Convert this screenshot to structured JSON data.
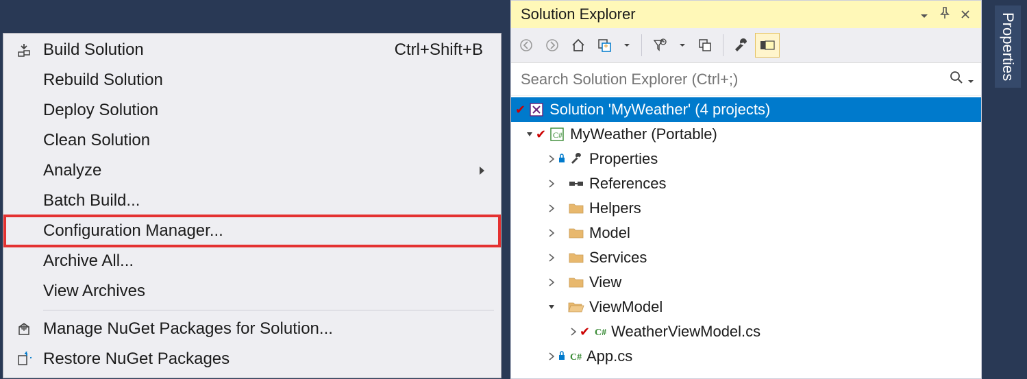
{
  "menu": {
    "items": [
      {
        "label": "Build Solution",
        "shortcut": "Ctrl+Shift+B",
        "icon": "build"
      },
      {
        "label": "Rebuild Solution"
      },
      {
        "label": "Deploy Solution"
      },
      {
        "label": "Clean Solution"
      },
      {
        "label": "Analyze",
        "submenu": true
      },
      {
        "label": "Batch Build..."
      },
      {
        "label": "Configuration Manager...",
        "highlighted": true
      },
      {
        "label": "Archive All..."
      },
      {
        "label": "View Archives"
      }
    ],
    "sep_after_index": 8,
    "items2": [
      {
        "label": "Manage NuGet Packages for Solution...",
        "icon": "package"
      },
      {
        "label": "Restore NuGet Packages",
        "icon": "restore"
      }
    ]
  },
  "panel": {
    "title": "Solution Explorer",
    "search_placeholder": "Search Solution Explorer (Ctrl+;)"
  },
  "tree": {
    "solution_label": "Solution 'MyWeather' (4 projects)",
    "project_label": "MyWeather (Portable)",
    "nodes": [
      {
        "label": "Properties",
        "icon": "wrench",
        "arrow": "right"
      },
      {
        "label": "References",
        "icon": "ref",
        "arrow": "right"
      },
      {
        "label": "Helpers",
        "icon": "folder",
        "arrow": "right"
      },
      {
        "label": "Model",
        "icon": "folder",
        "arrow": "right"
      },
      {
        "label": "Services",
        "icon": "folder",
        "arrow": "right"
      },
      {
        "label": "View",
        "icon": "folder",
        "arrow": "right"
      },
      {
        "label": "ViewModel",
        "icon": "folder",
        "arrow": "down"
      }
    ],
    "vm_child": "WeatherViewModel.cs",
    "app_file": "App.cs"
  },
  "side_tab": {
    "label": "Properties"
  }
}
